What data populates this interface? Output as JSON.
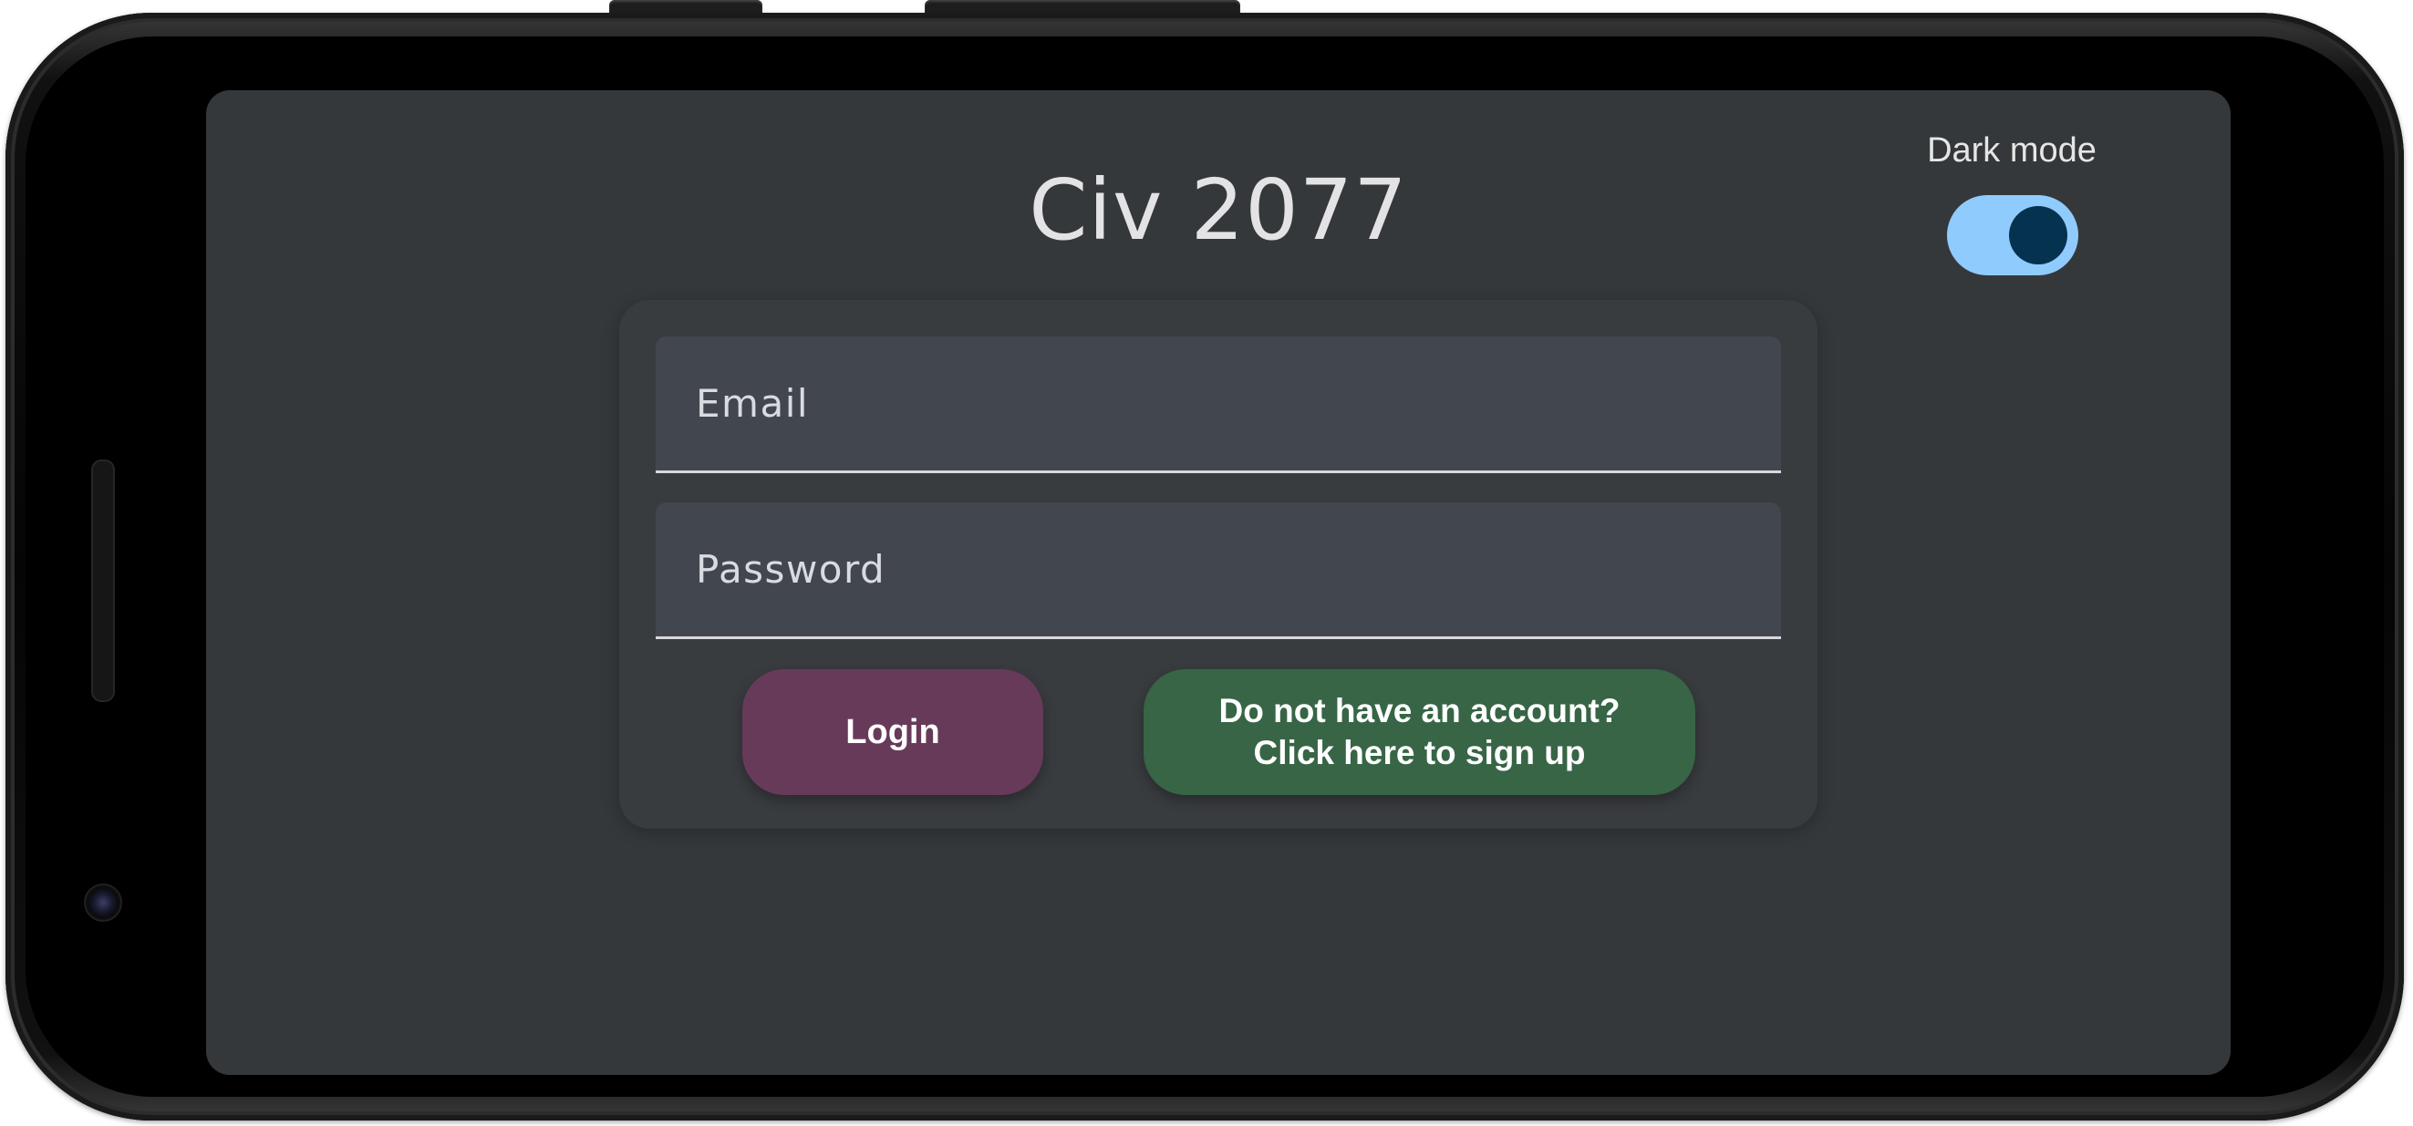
{
  "app": {
    "title": "Civ 2077"
  },
  "dark_mode": {
    "label": "Dark mode",
    "enabled": true,
    "track_color": "#90cbfd",
    "knob_color": "#05324f"
  },
  "login_form": {
    "email": {
      "placeholder": "Email",
      "value": ""
    },
    "password": {
      "placeholder": "Password",
      "value": ""
    },
    "login_button": {
      "label": "Login",
      "color": "#673a5a"
    },
    "signup_button": {
      "line1": "Do not have an account?",
      "line2": "Click here to sign up",
      "color": "#376546"
    }
  },
  "colors": {
    "screen_background": "#35383b",
    "card_background": "#393c3f",
    "field_background": "#42474f"
  }
}
